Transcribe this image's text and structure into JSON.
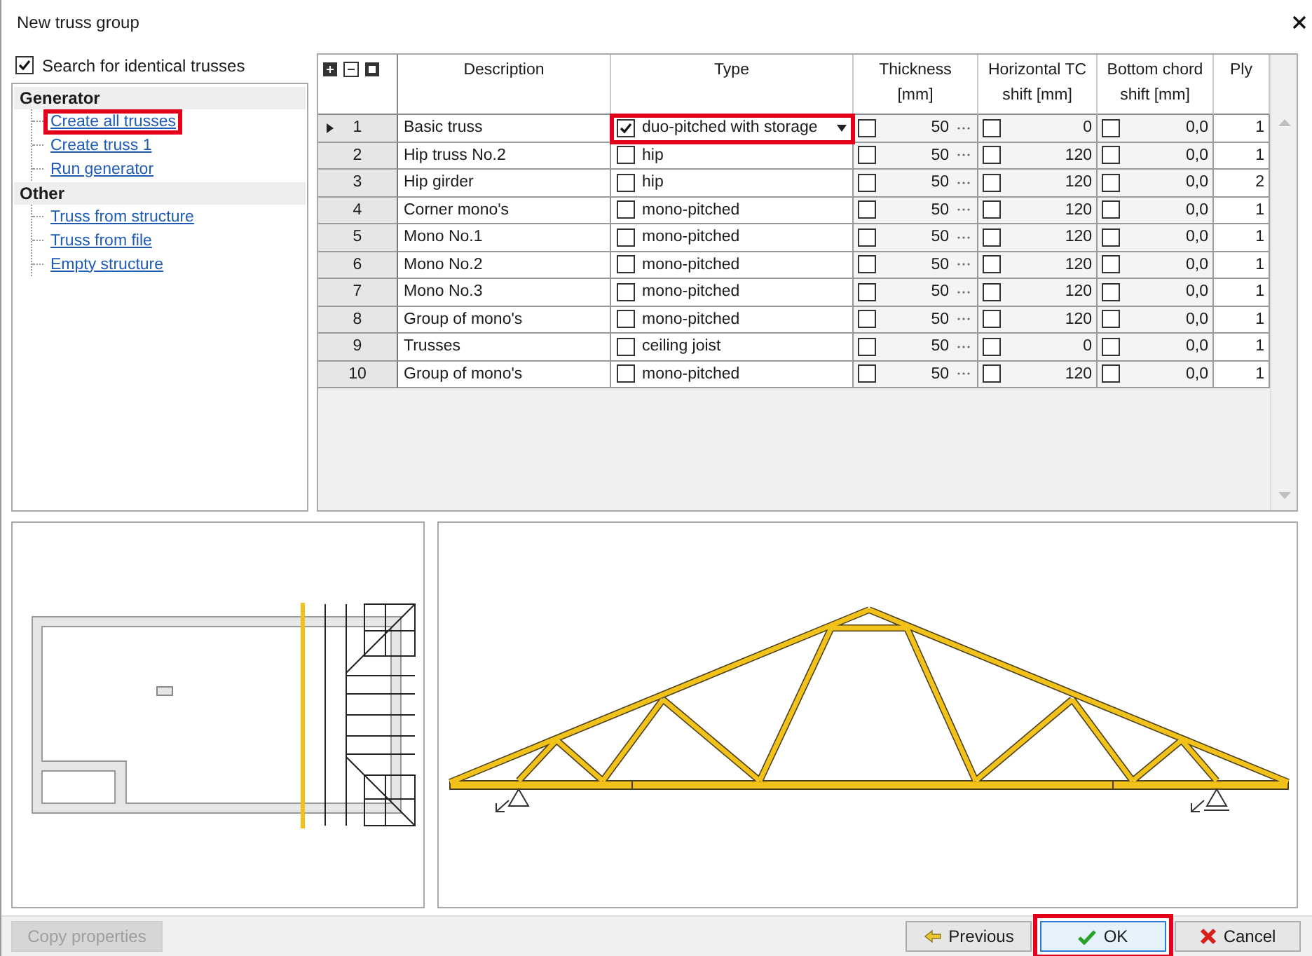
{
  "window": {
    "title": "New truss group"
  },
  "search_identical": {
    "label": "Search for identical trusses",
    "checked": true
  },
  "tree": [
    {
      "label": "Generator",
      "children": [
        {
          "label": "Create all trusses",
          "highlighted": true
        },
        {
          "label": "Create truss 1",
          "highlighted": false
        },
        {
          "label": "Run generator",
          "highlighted": false
        }
      ]
    },
    {
      "label": "Other",
      "children": [
        {
          "label": "Truss from structure",
          "highlighted": false
        },
        {
          "label": "Truss from file",
          "highlighted": false
        },
        {
          "label": "Empty structure",
          "highlighted": false
        }
      ]
    }
  ],
  "table": {
    "columns": [
      {
        "lines": [
          "Description"
        ]
      },
      {
        "lines": [
          "Type"
        ]
      },
      {
        "lines": [
          "Thickness",
          "[mm]"
        ]
      },
      {
        "lines": [
          "Horizontal TC",
          "shift [mm]"
        ]
      },
      {
        "lines": [
          "Bottom chord",
          "shift [mm]"
        ]
      },
      {
        "lines": [
          "Ply"
        ]
      }
    ],
    "rows": [
      {
        "number": "1",
        "selected": true,
        "description": "Basic truss",
        "type_checked": true,
        "type": "duo-pitched with storage",
        "highlighted": true,
        "thickness_checked": false,
        "thickness": "50",
        "htc_checked": false,
        "htc": "0",
        "bc_checked": false,
        "bc": "0,0",
        "ply": "1"
      },
      {
        "number": "2",
        "selected": false,
        "description": "Hip truss No.2",
        "type_checked": false,
        "type": "hip",
        "highlighted": false,
        "thickness_checked": false,
        "thickness": "50",
        "htc_checked": false,
        "htc": "120",
        "bc_checked": false,
        "bc": "0,0",
        "ply": "1"
      },
      {
        "number": "3",
        "selected": false,
        "description": "Hip girder",
        "type_checked": false,
        "type": "hip",
        "highlighted": false,
        "thickness_checked": false,
        "thickness": "50",
        "htc_checked": false,
        "htc": "120",
        "bc_checked": false,
        "bc": "0,0",
        "ply": "2"
      },
      {
        "number": "4",
        "selected": false,
        "description": "Corner mono's",
        "type_checked": false,
        "type": "mono-pitched",
        "highlighted": false,
        "thickness_checked": false,
        "thickness": "50",
        "htc_checked": false,
        "htc": "120",
        "bc_checked": false,
        "bc": "0,0",
        "ply": "1"
      },
      {
        "number": "5",
        "selected": false,
        "description": "Mono No.1",
        "type_checked": false,
        "type": "mono-pitched",
        "highlighted": false,
        "thickness_checked": false,
        "thickness": "50",
        "htc_checked": false,
        "htc": "120",
        "bc_checked": false,
        "bc": "0,0",
        "ply": "1"
      },
      {
        "number": "6",
        "selected": false,
        "description": "Mono No.2",
        "type_checked": false,
        "type": "mono-pitched",
        "highlighted": false,
        "thickness_checked": false,
        "thickness": "50",
        "htc_checked": false,
        "htc": "120",
        "bc_checked": false,
        "bc": "0,0",
        "ply": "1"
      },
      {
        "number": "7",
        "selected": false,
        "description": "Mono No.3",
        "type_checked": false,
        "type": "mono-pitched",
        "highlighted": false,
        "thickness_checked": false,
        "thickness": "50",
        "htc_checked": false,
        "htc": "120",
        "bc_checked": false,
        "bc": "0,0",
        "ply": "1"
      },
      {
        "number": "8",
        "selected": false,
        "description": "Group of mono's",
        "type_checked": false,
        "type": "mono-pitched",
        "highlighted": false,
        "thickness_checked": false,
        "thickness": "50",
        "htc_checked": false,
        "htc": "120",
        "bc_checked": false,
        "bc": "0,0",
        "ply": "1"
      },
      {
        "number": "9",
        "selected": false,
        "description": "Trusses",
        "type_checked": false,
        "type": "ceiling joist",
        "highlighted": false,
        "thickness_checked": false,
        "thickness": "50",
        "htc_checked": false,
        "htc": "0",
        "bc_checked": false,
        "bc": "0,0",
        "ply": "1"
      },
      {
        "number": "10",
        "selected": false,
        "description": "Group of mono's",
        "type_checked": false,
        "type": "mono-pitched",
        "highlighted": false,
        "thickness_checked": false,
        "thickness": "50",
        "htc_checked": false,
        "htc": "120",
        "bc_checked": false,
        "bc": "0,0",
        "ply": "1"
      }
    ]
  },
  "buttons": [
    {
      "label": "Copy properties",
      "kind": "copy",
      "disabled": true,
      "highlighted": false
    },
    {
      "label": "Previous",
      "kind": "previous",
      "disabled": false,
      "highlighted": false
    },
    {
      "label": "OK",
      "kind": "ok",
      "disabled": false,
      "highlighted": true
    },
    {
      "label": "Cancel",
      "kind": "cancel",
      "disabled": false,
      "highlighted": false
    }
  ]
}
